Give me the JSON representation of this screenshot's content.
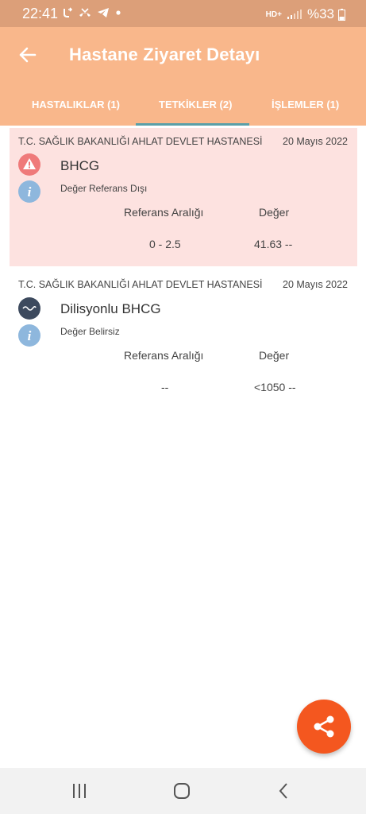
{
  "status_bar": {
    "time": "22:41",
    "network": "HD+",
    "battery": "%33",
    "icons": [
      "call-forward-icon",
      "missed-call-icon",
      "telegram-icon",
      "dot-icon",
      "signal-icon",
      "battery-icon"
    ]
  },
  "header": {
    "title": "Hastane Ziyaret Detayı",
    "back_icon": "back-arrow-icon"
  },
  "tabs": [
    {
      "label": "HASTALIKLAR (1)",
      "active": false
    },
    {
      "label": "TETKİKLER (2)",
      "active": true
    },
    {
      "label": "İŞLEMLER (1)",
      "active": false
    }
  ],
  "tests": [
    {
      "hospital": "T.C. SAĞLIK BAKANLIĞI AHLAT DEVLET HASTANESİ",
      "date": "20 Mayıs 2022",
      "name": "BHCG",
      "status": "Değer Referans Dışı",
      "ref_header": "Referans Aralığı",
      "value_header": "Değer",
      "ref_range": "0 - 2.5",
      "value": "41.63 --",
      "icon": "warning-icon",
      "highlight_color": "#fde2e0"
    },
    {
      "hospital": "T.C. SAĞLIK BAKANLIĞI AHLAT DEVLET HASTANESİ",
      "date": "20 Mayıs 2022",
      "name": "Dilisyonlu BHCG",
      "status": "Değer Belirsiz",
      "ref_header": "Referans Aralığı",
      "value_header": "Değer",
      "ref_range": "--",
      "value": "<1050 --",
      "icon": "wave-icon"
    }
  ],
  "colors": {
    "status_bar": "#dc9f79",
    "app_bar": "#f9b78b",
    "tab_indicator": "#5a9fa7",
    "fab": "#f4571f"
  },
  "fab": {
    "icon": "share-icon"
  },
  "nav": {
    "icons": [
      "recent-apps-icon",
      "home-icon",
      "back-icon"
    ]
  }
}
